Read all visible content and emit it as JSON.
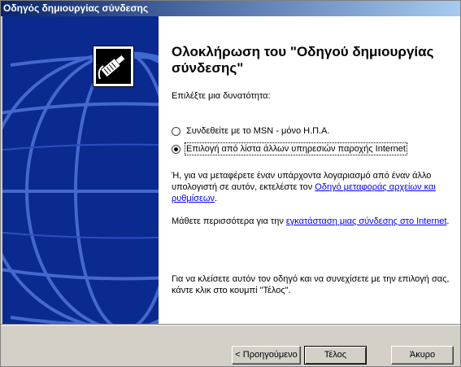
{
  "window": {
    "title": "Οδηγός δημιουργίας σύνδεσης"
  },
  "main": {
    "heading": "Ολοκλήρωση του \"Οδηγού δημιουργίας σύνδεσης\"",
    "prompt": "Επιλέξτε μια δυνατότητα:",
    "options": [
      {
        "label": "Συνδεθείτε με το MSN - μόνο Η.Π.Α.",
        "selected": false
      },
      {
        "label": "Επιλογή από λίστα άλλων υπηρεσιών παροχής Internet",
        "selected": true
      }
    ],
    "transfer_text": "Ή, για να μεταφέρετε έναν υπάρχοντα λογαριασμό από έναν άλλο υπολογιστή σε αυτόν, εκτελέστε τον",
    "transfer_link": "Οδηγό μεταφοράς αρχείων και ρυθμίσεων",
    "transfer_end": ".",
    "learn_text": "Μάθετε περισσότερα για την",
    "learn_link": "εγκατάσταση μιας σύνδεσης στο Internet",
    "learn_end": ".",
    "finish_text": "Για να κλείσετε αυτόν τον οδηγό και να συνεχίσετε με την επιλογή σας, κάντε κλικ στο κουμπί \"Τέλος\"."
  },
  "buttons": {
    "back": "< Προηγούμενο",
    "finish": "Τέλος",
    "cancel": "Άκυρο"
  },
  "colors": {
    "panel": "#0b2a8f",
    "link": "#0000ee"
  }
}
